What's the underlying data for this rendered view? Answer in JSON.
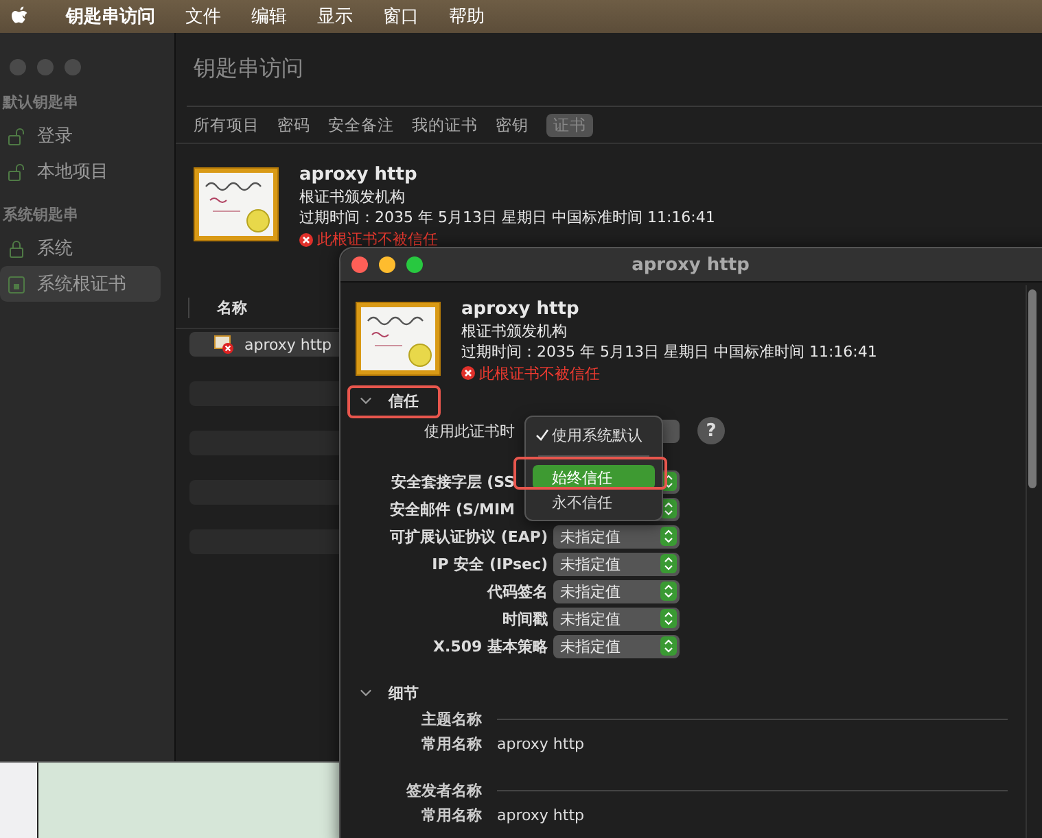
{
  "menu_bar": {
    "app_name": "钥匙串访问",
    "items": [
      "文件",
      "编辑",
      "显示",
      "窗口",
      "帮助"
    ]
  },
  "main_window": {
    "title": "钥匙串访问",
    "sidebar": [
      {
        "heading": "默认钥匙串",
        "items": [
          {
            "label": "登录",
            "kind": "unlocked",
            "selected": false
          },
          {
            "label": "本地项目",
            "kind": "unlocked",
            "selected": false
          }
        ]
      },
      {
        "heading": "系统钥匙串",
        "items": [
          {
            "label": "系统",
            "kind": "locked",
            "selected": false
          },
          {
            "label": "系统根证书",
            "kind": "cabinet",
            "selected": true
          }
        ]
      }
    ],
    "tabs": [
      {
        "label": "所有项目",
        "selected": false
      },
      {
        "label": "密码",
        "selected": false
      },
      {
        "label": "安全备注",
        "selected": false
      },
      {
        "label": "我的证书",
        "selected": false
      },
      {
        "label": "密钥",
        "selected": false
      },
      {
        "label": "证书",
        "selected": true
      }
    ],
    "certificate": {
      "name": "aproxy http",
      "kind": "根证书颁发机构",
      "expires": "过期时间：2035 年 5月13日 星期日 中国标准时间 11:16:41",
      "warning": "此根证书不被信任"
    },
    "table": {
      "columns": [
        "名称"
      ],
      "rows": [
        {
          "name": "aproxy http",
          "selected": true
        }
      ]
    }
  },
  "dialog": {
    "title": "aproxy http",
    "certificate": {
      "name": "aproxy http",
      "kind": "根证书颁发机构",
      "expires": "过期时间：2035 年 5月13日 星期日 中国标准时间 11:16:41",
      "warning": "此根证书不被信任"
    },
    "trust": {
      "heading": "信任",
      "expanded": true,
      "annotated": true,
      "usage_label": "使用此证书时",
      "help": "?",
      "rows": [
        {
          "label": "安全套接字层 (SS"
        },
        {
          "label": "安全邮件 (S/MIM"
        },
        {
          "label": "可扩展认证协议 (EAP)",
          "value": "未指定值"
        },
        {
          "label": "IP 安全 (IPsec)",
          "value": "未指定值"
        },
        {
          "label": "代码签名",
          "value": "未指定值"
        },
        {
          "label": "时间戳",
          "value": "未指定值"
        },
        {
          "label": "X.509 基本策略",
          "value": "未指定值"
        }
      ]
    },
    "popup_menu": [
      {
        "label": "使用系统默认",
        "checked": true,
        "highlighted": false,
        "annotated": false
      },
      {
        "label": "始终信任",
        "checked": false,
        "highlighted": true,
        "annotated": true
      },
      {
        "label": "永不信任",
        "checked": false,
        "highlighted": false,
        "annotated": false
      }
    ],
    "details": {
      "heading": "细节",
      "expanded": true,
      "groups": [
        {
          "heading": "主题名称",
          "fields": [
            {
              "label": "常用名称",
              "value": "aproxy http"
            }
          ]
        },
        {
          "heading": "签发者名称",
          "fields": [
            {
              "label": "常用名称",
              "value": "aproxy http"
            }
          ]
        }
      ]
    }
  }
}
